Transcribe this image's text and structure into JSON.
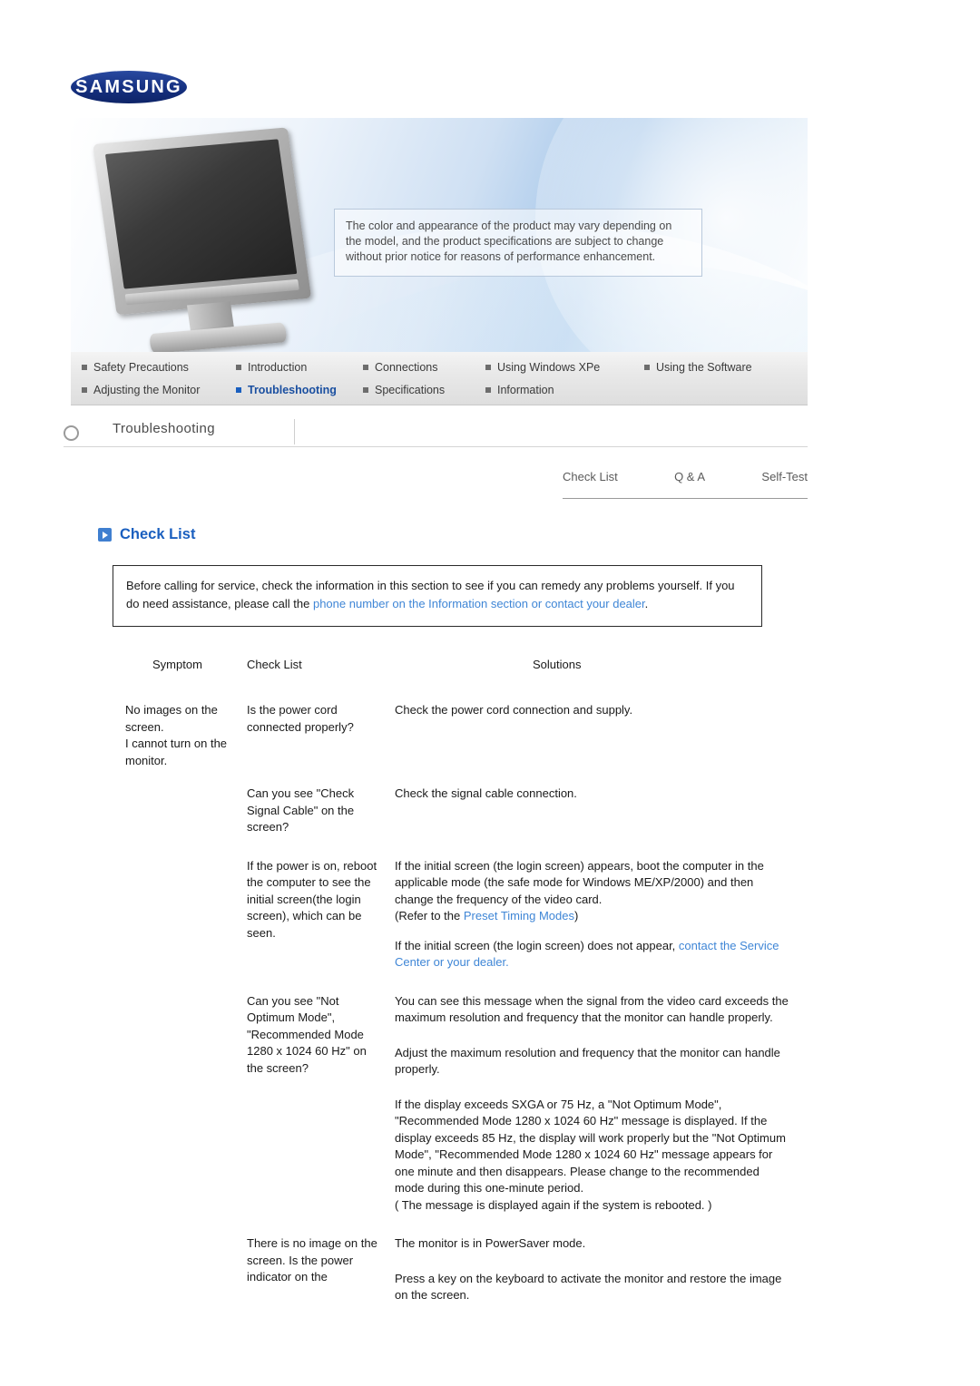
{
  "brand": {
    "logo_text": "SAMSUNG"
  },
  "banner": {
    "caption": "The color and appearance of the product may vary depending on the model, and the product specifications are subject to change without prior notice for reasons of performance enhancement."
  },
  "nav": {
    "row1": [
      {
        "label": "Safety Precautions",
        "active": false
      },
      {
        "label": "Introduction",
        "active": false
      },
      {
        "label": "Connections",
        "active": false
      },
      {
        "label": "Using Windows XPe",
        "active": false
      },
      {
        "label": "Using the Software",
        "active": false
      }
    ],
    "row2": [
      {
        "label": "Adjusting the Monitor",
        "active": false
      },
      {
        "label": "Troubleshooting",
        "active": true
      },
      {
        "label": "Specifications",
        "active": false
      },
      {
        "label": "Information",
        "active": false
      }
    ]
  },
  "section": {
    "title": "Troubleshooting"
  },
  "subtabs": [
    {
      "label": "Check List"
    },
    {
      "label": "Q & A"
    },
    {
      "label": "Self-Test"
    }
  ],
  "page_title": "Check List",
  "intro": {
    "text_before": "Before calling for service, check the information in this section to see if you can remedy any problems yourself. If you do need assistance, please call the ",
    "link_text": "phone number on the Information section or contact your dealer",
    "text_after": "."
  },
  "table": {
    "headers": {
      "symptom": "Symptom",
      "checklist": "Check List",
      "solutions": "Solutions"
    },
    "rows": [
      {
        "symptom": "No images on the screen.\nI cannot turn on the monitor.",
        "checklist": "Is the power cord connected properly?",
        "solutions": [
          "Check the power cord connection and supply."
        ]
      },
      {
        "symptom": "",
        "checklist": "Can you see \"Check Signal Cable\" on the screen?",
        "solutions": [
          "Check the signal cable connection."
        ]
      },
      {
        "symptom": "",
        "checklist": "If the power is on, reboot the computer to see the initial screen(the login screen), which can be seen.",
        "solutions": [
          "If the initial screen (the login screen) appears, boot the computer in the applicable mode (the safe mode for Windows ME/XP/2000) and then change the frequency of the video card.",
          "(Refer to the ",
          "Preset Timing Modes",
          ")",
          "If the initial screen (the login screen) does not appear, ",
          "contact the Service Center or your dealer."
        ]
      },
      {
        "symptom": "",
        "checklist": "Can you see \"Not Optimum Mode\", \"Recommended Mode 1280 x 1024 60 Hz\" on the screen?",
        "solutions": [
          "You can see this message when the signal from the video card exceeds the maximum resolution and frequency that the monitor can handle properly.",
          "Adjust the maximum resolution and frequency that the monitor can handle properly.",
          "If the display exceeds SXGA or 75 Hz, a \"Not Optimum Mode\", \"Recommended Mode 1280 x 1024 60 Hz\" message is displayed. If the display exceeds 85 Hz, the display will work properly but the \"Not Optimum Mode\", \"Recommended Mode 1280 x 1024 60 Hz\" message appears for one minute and then disappears. Please change to the recommended mode during this one-minute period.",
          "( The message is displayed again if the system is rebooted. )"
        ]
      },
      {
        "symptom": "",
        "checklist": "There is no image on the screen. Is the power indicator on the",
        "solutions": [
          "The monitor is in PowerSaver mode.",
          "Press a key on the keyboard to activate the monitor and restore the image on the screen."
        ]
      }
    ]
  }
}
